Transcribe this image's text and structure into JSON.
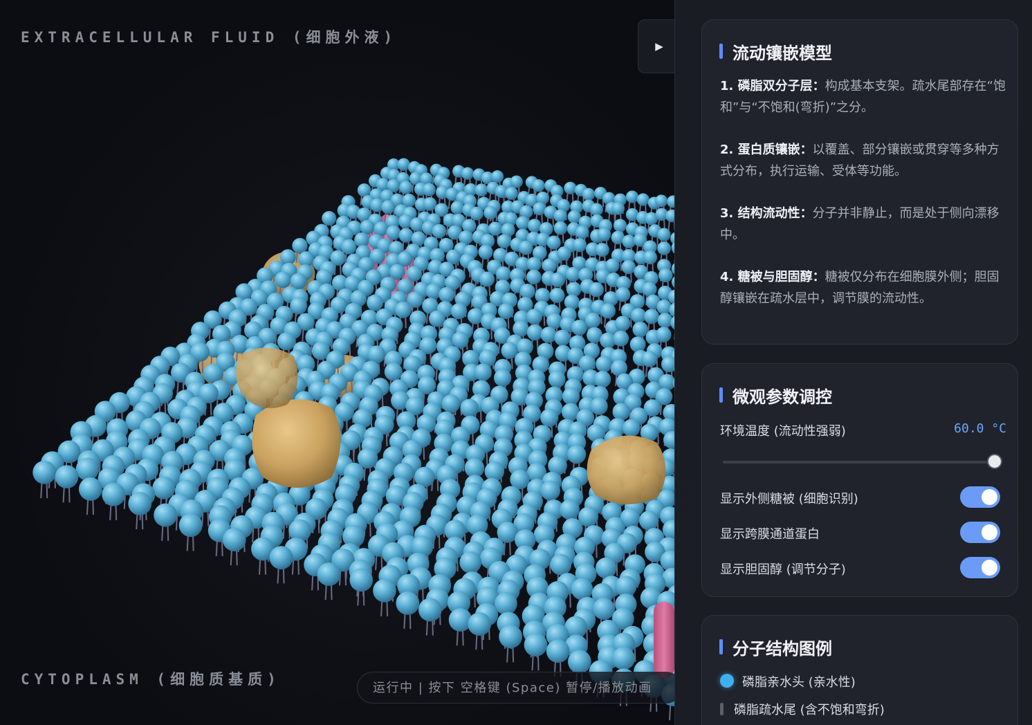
{
  "scene": {
    "label_top": "EXTRACELLULAR FLUID (细胞外液)",
    "label_bottom": "CYTOPLASM (细胞质基质)",
    "play_icon": "▶",
    "status": "运行中 | 按下 空格键 (Space) 暂停/播放动画",
    "colors": {
      "lipid_head": "#5fb3d8",
      "channel_protein": "#d9709b",
      "peripheral_protein": "#d6b06c",
      "tail": "#6a6c86"
    }
  },
  "info_card": {
    "title": "流动镶嵌模型",
    "items": [
      {
        "label": "1. 磷脂双分子层：",
        "text": "构成基本支架。疏水尾部存在“饱和”与“不饱和(弯折)”之分。"
      },
      {
        "label": "2. 蛋白质镶嵌：",
        "text": "以覆盖、部分镶嵌或贯穿等多种方式分布，执行运输、受体等功能。"
      },
      {
        "label": "3. 结构流动性：",
        "text": "分子并非静止，而是处于侧向漂移中。"
      },
      {
        "label": "4. 糖被与胆固醇：",
        "text": "糖被仅分布在细胞膜外侧；胆固醇镶嵌在疏水层中，调节膜的流动性。"
      }
    ]
  },
  "params_card": {
    "title": "微观参数调控",
    "temp_label": "环境温度 (流动性强弱)",
    "temp_value": "60.0 °C",
    "temp_level": 1.0,
    "toggles": [
      {
        "label": "显示外侧糖被 (细胞识别)",
        "on": true
      },
      {
        "label": "显示跨膜通道蛋白",
        "on": true
      },
      {
        "label": "显示胆固醇 (调节分子)",
        "on": true
      }
    ]
  },
  "legend_card": {
    "title": "分子结构图例",
    "items": [
      {
        "label": "磷脂亲水头 (亲水性)",
        "color": "#3fb0ee"
      },
      {
        "label": "磷脂疏水尾 (含不饱和弯折)",
        "color": "#5a5f6b"
      }
    ]
  }
}
